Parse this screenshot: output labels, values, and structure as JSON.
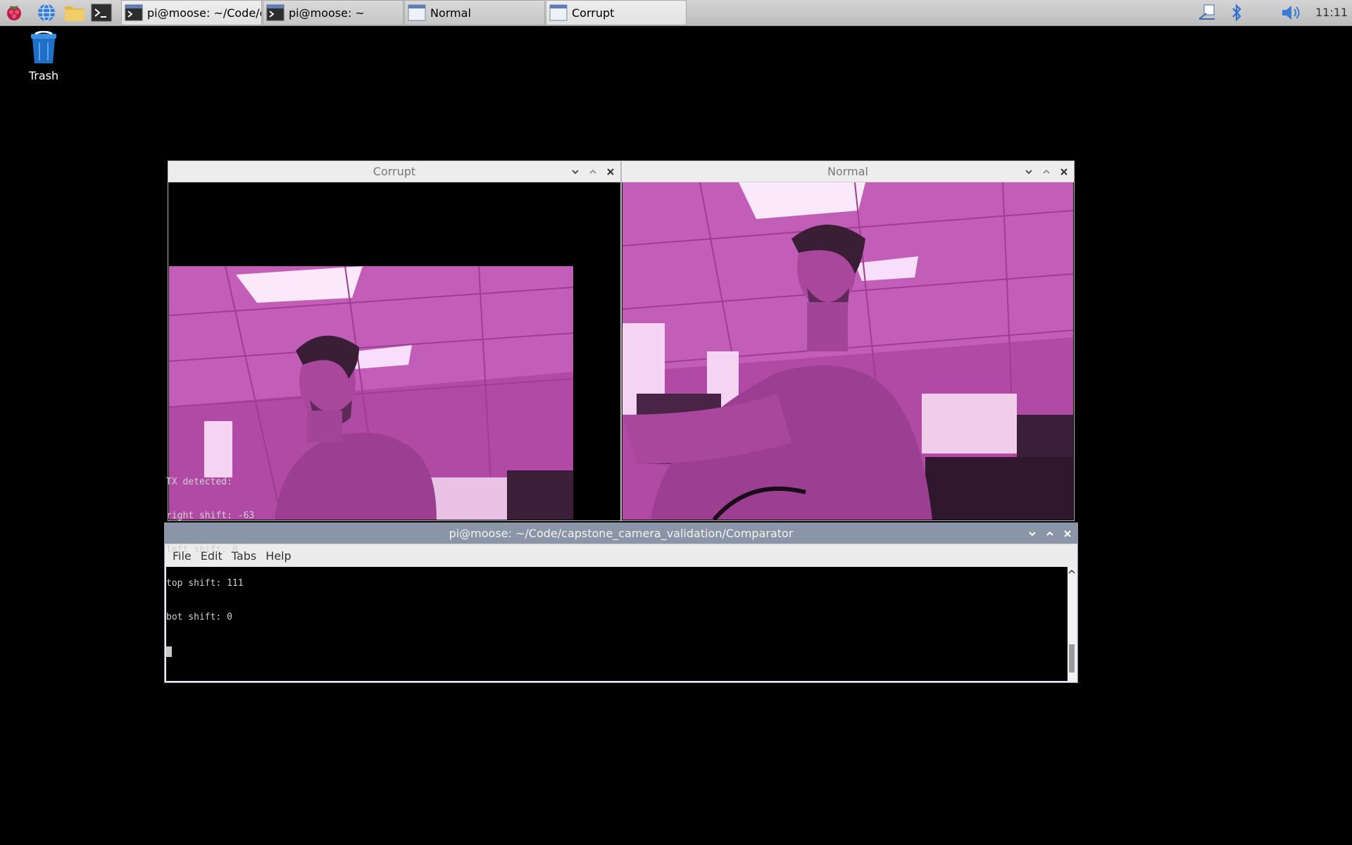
{
  "taskbar": {
    "launchers": [
      "raspberry-menu-icon",
      "browser-icon",
      "file-manager-icon",
      "terminal-icon"
    ],
    "tasks": [
      {
        "label": "pi@moose: ~/Code/c...",
        "icon": "terminal-icon",
        "active": true
      },
      {
        "label": "pi@moose: ~",
        "icon": "terminal-icon",
        "active": false
      },
      {
        "label": "Normal",
        "icon": "window-icon",
        "active": false
      },
      {
        "label": "Corrupt",
        "icon": "window-icon",
        "active": true
      }
    ],
    "tray": [
      "file-transfer-icon",
      "bluetooth-icon",
      "volume-icon"
    ],
    "clock": "11:11"
  },
  "desktop": {
    "trash_label": "Trash"
  },
  "windows": {
    "corrupt": {
      "title": "Corrupt"
    },
    "normal": {
      "title": "Normal"
    },
    "terminal": {
      "title": "pi@moose: ~/Code/capstone_camera_validation/Comparator",
      "menu": [
        "File",
        "Edit",
        "Tabs",
        "Help"
      ],
      "lines": [
        "TX detected:",
        "right shift: -63",
        "left shift: 0",
        "top shift: 111",
        "bot shift: 0"
      ]
    }
  },
  "colors": {
    "camera_tint": "#b04aa5",
    "terminal_title_bg": "#8a96a8"
  }
}
